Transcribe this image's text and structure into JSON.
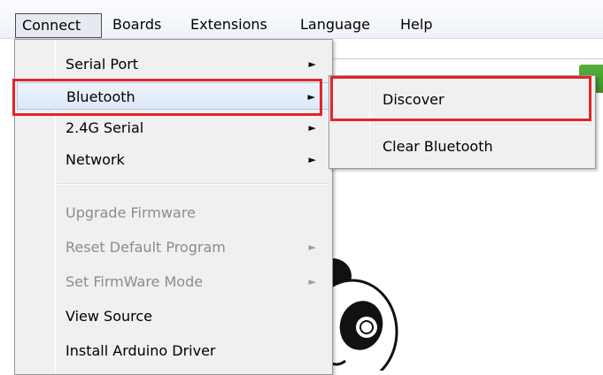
{
  "menubar": {
    "items": [
      {
        "label": "Connect"
      },
      {
        "label": "Boards"
      },
      {
        "label": "Extensions"
      },
      {
        "label": "Language"
      },
      {
        "label": "Help"
      }
    ]
  },
  "connect_menu": {
    "items": [
      {
        "label": "Serial Port",
        "has_submenu": true,
        "enabled": true
      },
      {
        "label": "Bluetooth",
        "has_submenu": true,
        "enabled": true,
        "highlighted": true
      },
      {
        "label": "2.4G Serial",
        "has_submenu": true,
        "enabled": true
      },
      {
        "label": "Network",
        "has_submenu": true,
        "enabled": true
      },
      {
        "label": "Upgrade Firmware",
        "has_submenu": false,
        "enabled": false
      },
      {
        "label": "Reset Default Program",
        "has_submenu": true,
        "enabled": false
      },
      {
        "label": "Set FirmWare Mode",
        "has_submenu": true,
        "enabled": false
      },
      {
        "label": "View Source",
        "has_submenu": false,
        "enabled": true
      },
      {
        "label": "Install Arduino Driver",
        "has_submenu": false,
        "enabled": true
      }
    ],
    "arrow_glyph": "►"
  },
  "bluetooth_submenu": {
    "items": [
      {
        "label": "Discover",
        "highlighted": true
      },
      {
        "label": "Clear Bluetooth"
      }
    ]
  },
  "colors": {
    "highlight_outline": "#e0262a",
    "menu_background": "#f0f0f0",
    "disabled_text": "#8c8c8c",
    "app_accent_green": "#54b33a"
  }
}
